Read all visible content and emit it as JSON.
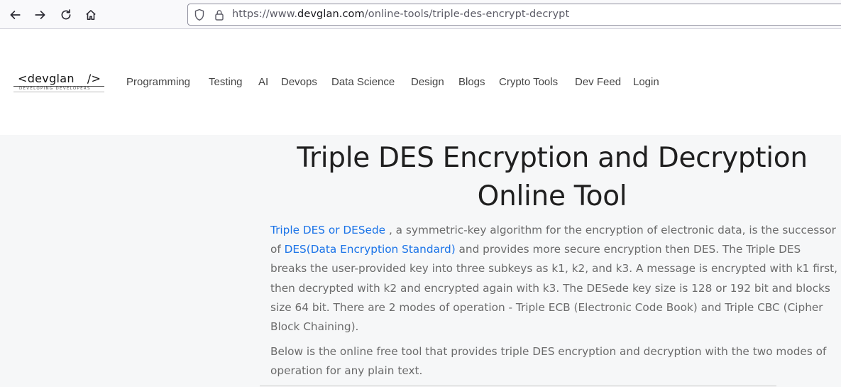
{
  "browser": {
    "url_prefix": "https://www.",
    "url_domain": "devglan.com",
    "url_path": "/online-tools/triple-des-encrypt-decrypt"
  },
  "icons": {
    "back": "arrow-left-icon",
    "forward": "arrow-right-icon",
    "reload": "reload-icon",
    "home": "home-icon",
    "shield": "shield-icon",
    "lock": "lock-icon"
  },
  "logo": {
    "left": "<devglan",
    "right": "/>",
    "tagline": "DEVELOPING DEVELOPERS"
  },
  "nav": {
    "items": [
      "Programming",
      "Testing",
      "AI",
      "Devops",
      "Data Science",
      "Design",
      "Blogs",
      "Crypto Tools",
      "Dev Feed",
      "Login"
    ]
  },
  "content": {
    "title_line1": "Triple DES Encryption and Decryption",
    "title_line2": "Online Tool",
    "p1_link1": "Triple DES or DESede",
    "p1_text1": " , a symmetric-key algorithm for the encryption of electronic data, is the successor of ",
    "p1_link2": "DES(Data Encryption Standard)",
    "p1_text2": " and provides more secure encryption then DES. The Triple DES breaks the user-provided key into three subkeys as k1, k2, and k3. A message is encrypted with k1 first, then decrypted with k2 and encrypted again with k3. The DESede key size is 128 or 192 bit and blocks size 64 bit. There are 2 modes of operation - Triple ECB (Electronic Code Book) and Triple CBC (Cipher Block Chaining).",
    "p2": "Below is the online free tool that provides triple DES encryption and decryption with the two modes of operation for any plain text."
  },
  "colors": {
    "link": "#1a73e8",
    "body_text": "#6b6b6b",
    "title": "#1f1f1f",
    "content_bg": "#f6f7f8"
  }
}
